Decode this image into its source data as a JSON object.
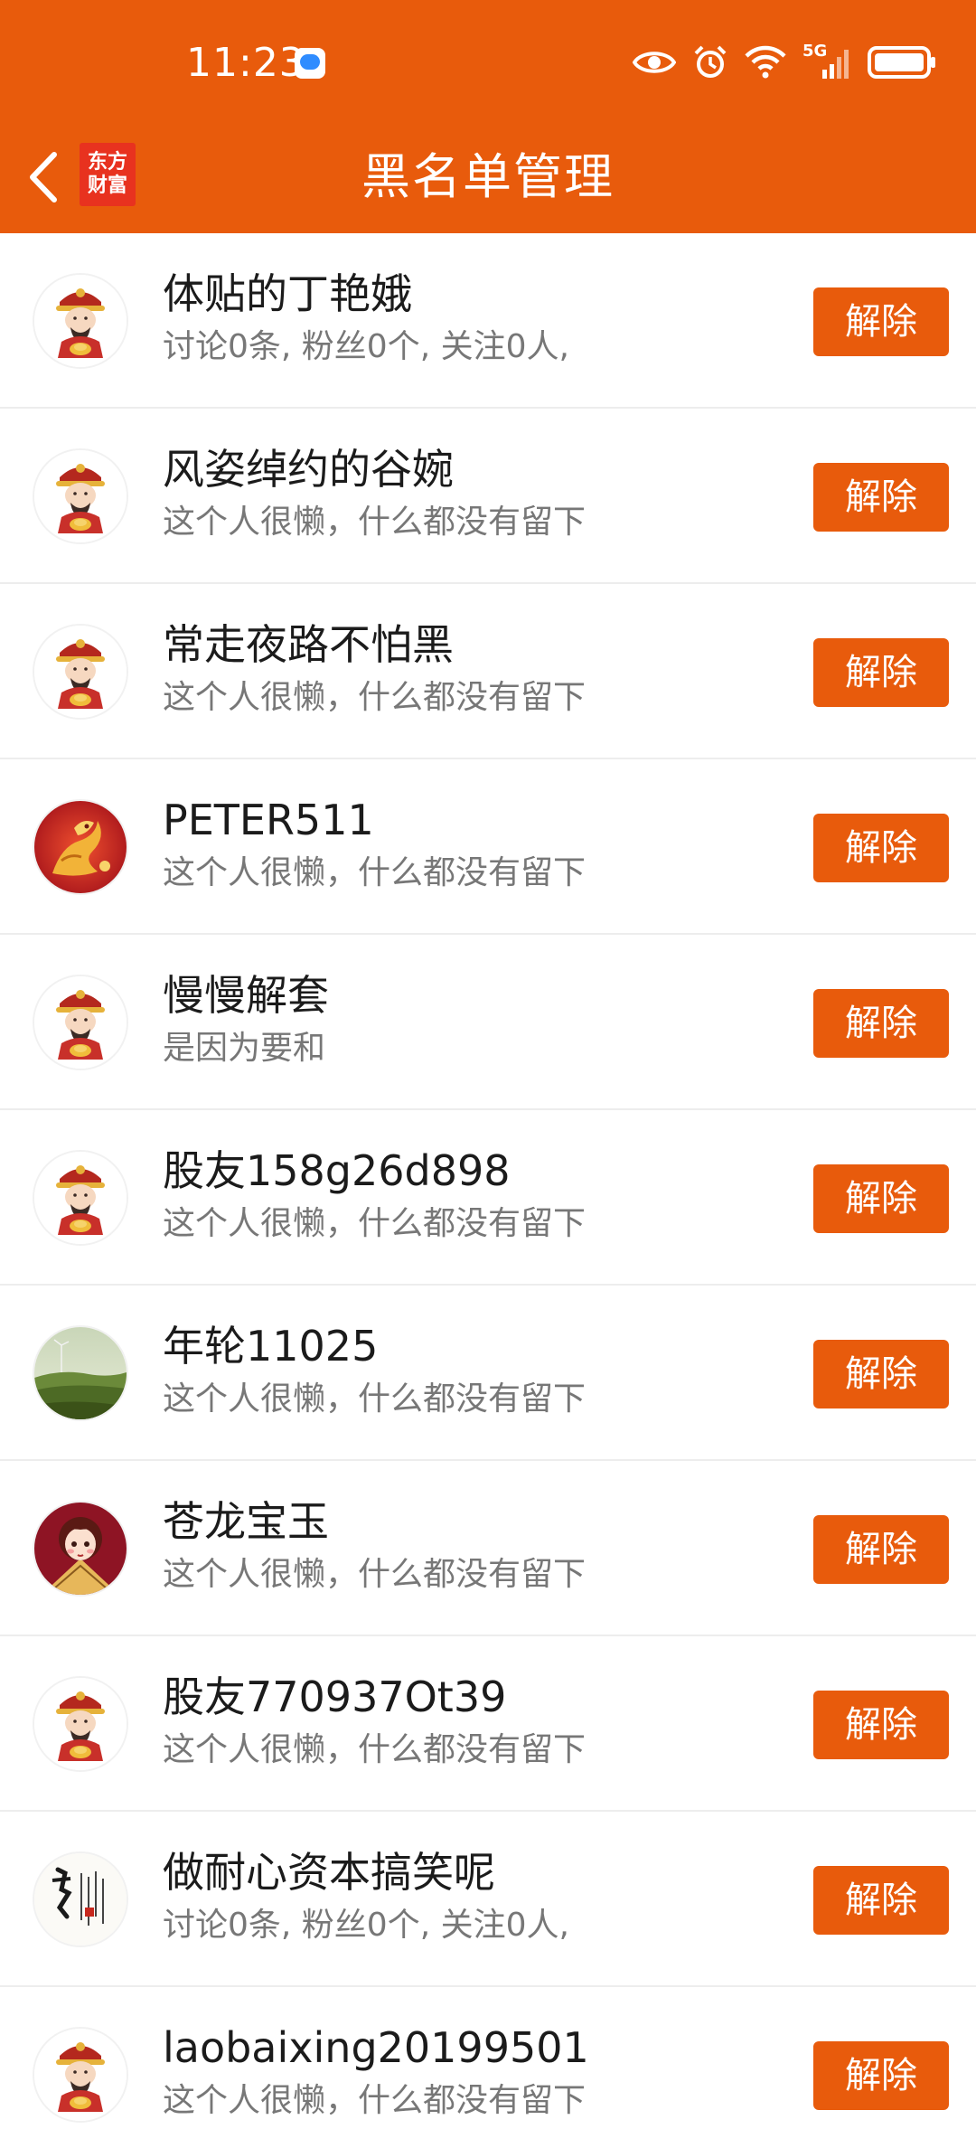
{
  "status_bar": {
    "time": "11:23",
    "network": "5G",
    "icons": [
      "message-notification-icon",
      "eye-icon",
      "alarm-icon",
      "wifi-icon",
      "signal-icon",
      "battery-icon"
    ]
  },
  "header": {
    "title": "黑名单管理",
    "brand_line1": "东方",
    "brand_line2": "财富",
    "back_icon": "chevron-left-icon"
  },
  "colors": {
    "accent": "#E85B0C",
    "brand_red": "#E8321F",
    "text_primary": "#1b1b1b",
    "text_secondary": "#777777",
    "divider": "#ededed"
  },
  "blacklist": [
    {
      "name": "体贴的丁艳娥",
      "desc": "讨论0条, 粉丝0个, 关注0人,",
      "avatar": "default-fortune-avatar",
      "button": "解除"
    },
    {
      "name": "风姿绰约的谷婉",
      "desc": "这个人很懒，什么都没有留下",
      "avatar": "default-fortune-avatar",
      "button": "解除"
    },
    {
      "name": "常走夜路不怕黑",
      "desc": "这个人很懒，什么都没有留下",
      "avatar": "default-fortune-avatar",
      "button": "解除"
    },
    {
      "name": "PETER511",
      "desc": "这个人很懒，什么都没有留下",
      "avatar": "dragon-avatar",
      "button": "解除"
    },
    {
      "name": "慢慢解套",
      "desc": "是因为要和",
      "avatar": "default-fortune-avatar",
      "button": "解除"
    },
    {
      "name": "股友158g26d898",
      "desc": "这个人很懒，什么都没有留下",
      "avatar": "default-fortune-avatar",
      "button": "解除"
    },
    {
      "name": "年轮11025",
      "desc": "这个人很懒，什么都没有留下",
      "avatar": "landscape-avatar",
      "button": "解除"
    },
    {
      "name": "苍龙宝玉",
      "desc": "这个人很懒，什么都没有留下",
      "avatar": "girl-fan-avatar",
      "button": "解除"
    },
    {
      "name": "股友770937Ot39",
      "desc": "这个人很懒，什么都没有留下",
      "avatar": "default-fortune-avatar",
      "button": "解除"
    },
    {
      "name": "做耐心资本搞笑呢",
      "desc": "讨论0条, 粉丝0个, 关注0人,",
      "avatar": "calligraphy-avatar",
      "button": "解除"
    },
    {
      "name": "laobaixing20199501",
      "desc": "这个人很懒，什么都没有留下",
      "avatar": "default-fortune-avatar",
      "button": "解除"
    }
  ]
}
